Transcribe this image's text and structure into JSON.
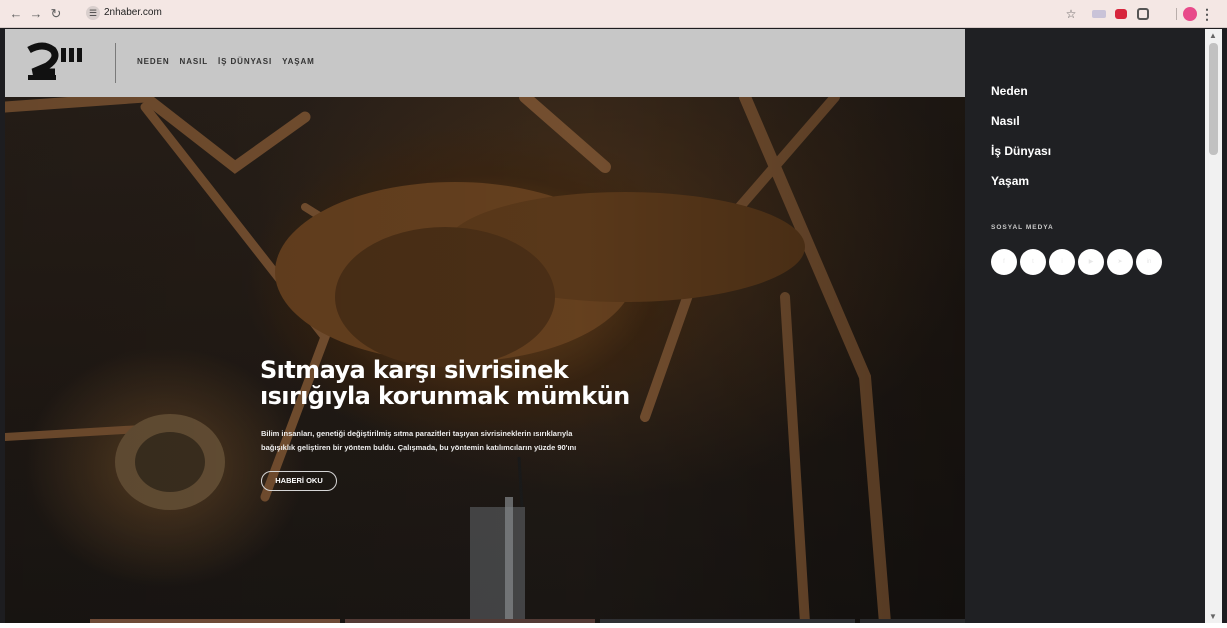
{
  "browser": {
    "url": "2nhaber.com",
    "back_icon": "arrow-left-icon",
    "forward_icon": "arrow-right-icon",
    "reload_icon": "reload-icon"
  },
  "site": {
    "logo_text": "2N",
    "nav": [
      "NEDEN",
      "NASIL",
      "İŞ DÜNYASI",
      "YAŞAM"
    ]
  },
  "hero": {
    "headline_line1": "Sıtmaya karşı sivrisinek",
    "headline_line2": "ısırığıyla korunmak mümkün",
    "summary_line1": "Bilim insanları, genetiği değiştirilmiş sıtma parazitleri taşıyan sivrisineklerin ısırıklarıyla",
    "summary_line2": "bağışıklık geliştiren bir yöntem buldu. Çalışmada, bu yöntemin katılımcıların yüzde 90'ını",
    "cta": "HABERİ OKU"
  },
  "side_menu": {
    "items": [
      "Neden",
      "Nasıl",
      "İş Dünyası",
      "Yaşam"
    ],
    "social_label": "SOSYAL MEDYA",
    "social_icons": [
      "facebook-icon",
      "twitter-icon",
      "instagram-icon",
      "youtube-icon",
      "telegram-icon",
      "linkedin-icon"
    ]
  },
  "colors": {
    "header_bg": "#c7c7c7",
    "side_bg": "#1f2023",
    "chrome_bg": "#f4e7e4"
  }
}
